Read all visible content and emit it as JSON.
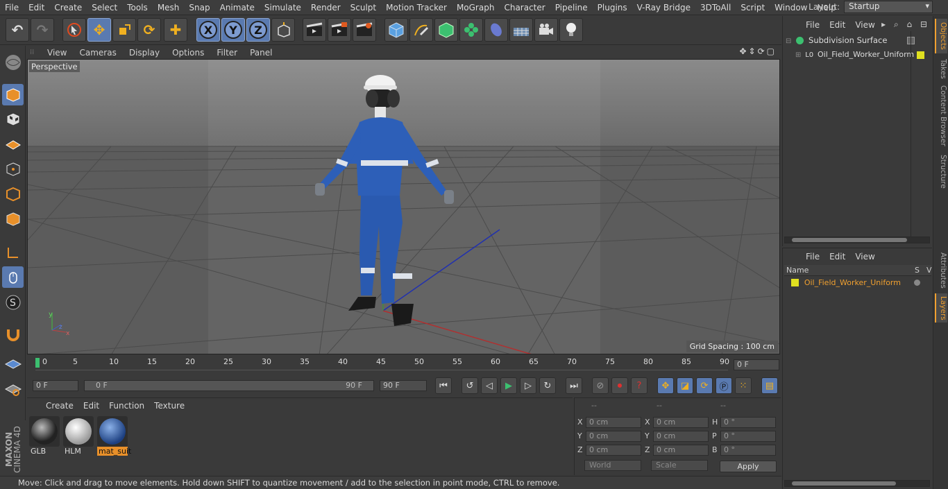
{
  "menu": [
    "File",
    "Edit",
    "Create",
    "Select",
    "Tools",
    "Mesh",
    "Snap",
    "Animate",
    "Simulate",
    "Render",
    "Sculpt",
    "Motion Tracker",
    "MoGraph",
    "Character",
    "Pipeline",
    "Plugins",
    "V-Ray Bridge",
    "3DToAll",
    "Script",
    "Window",
    "Help"
  ],
  "layout": {
    "label": "Layout:",
    "value": "Startup"
  },
  "toolbar": {
    "x": "X",
    "y": "Y",
    "z": "Z"
  },
  "viewport": {
    "menu": [
      "View",
      "Cameras",
      "Display",
      "Options",
      "Filter",
      "Panel"
    ],
    "label": "Perspective",
    "grid_spacing": "Grid Spacing : 100 cm"
  },
  "timeline": {
    "ticks": [
      "0",
      "5",
      "10",
      "15",
      "20",
      "25",
      "30",
      "35",
      "40",
      "45",
      "50",
      "55",
      "60",
      "65",
      "70",
      "75",
      "80",
      "85",
      "90"
    ],
    "current_frame": "0 F",
    "start": "0 F",
    "range_start": "0 F",
    "range_end": "90 F",
    "end": "90 F"
  },
  "materials": {
    "menu": [
      "Create",
      "Edit",
      "Function",
      "Texture"
    ],
    "items": [
      {
        "name": "GLB",
        "color": "#3a3a3a"
      },
      {
        "name": "HLM",
        "color": "#c8c8c8"
      },
      {
        "name": "mat_suit",
        "color": "#2f5fa0",
        "selected": true
      }
    ]
  },
  "coords": {
    "headers": [
      "--",
      "--",
      "--"
    ],
    "rows": [
      {
        "a": "X",
        "av": "0 cm",
        "b": "X",
        "bv": "0 cm",
        "c": "H",
        "cv": "0 °"
      },
      {
        "a": "Y",
        "av": "0 cm",
        "b": "Y",
        "bv": "0 cm",
        "c": "P",
        "cv": "0 °"
      },
      {
        "a": "Z",
        "av": "0 cm",
        "b": "Z",
        "bv": "0 cm",
        "c": "B",
        "cv": "0 °"
      }
    ],
    "space": "World",
    "mode": "Scale",
    "apply": "Apply"
  },
  "objects": {
    "menu": [
      "File",
      "Edit",
      "View"
    ],
    "items": [
      "Subdivision Surface",
      "Oil_Field_Worker_Uniform"
    ]
  },
  "layers": {
    "menu": [
      "File",
      "Edit",
      "View"
    ],
    "col_name": "Name",
    "col_s": "S",
    "col_v": "V",
    "items": [
      "Oil_Field_Worker_Uniform"
    ]
  },
  "side_tabs": [
    "Objects",
    "Takes",
    "Content Browser",
    "Structure",
    "Attributes",
    "Layers"
  ],
  "brand": {
    "a": "MAXON",
    "b": "CINEMA 4D"
  },
  "status": "Move: Click and drag to move elements. Hold down SHIFT to quantize movement / add to the selection in point mode, CTRL to remove."
}
